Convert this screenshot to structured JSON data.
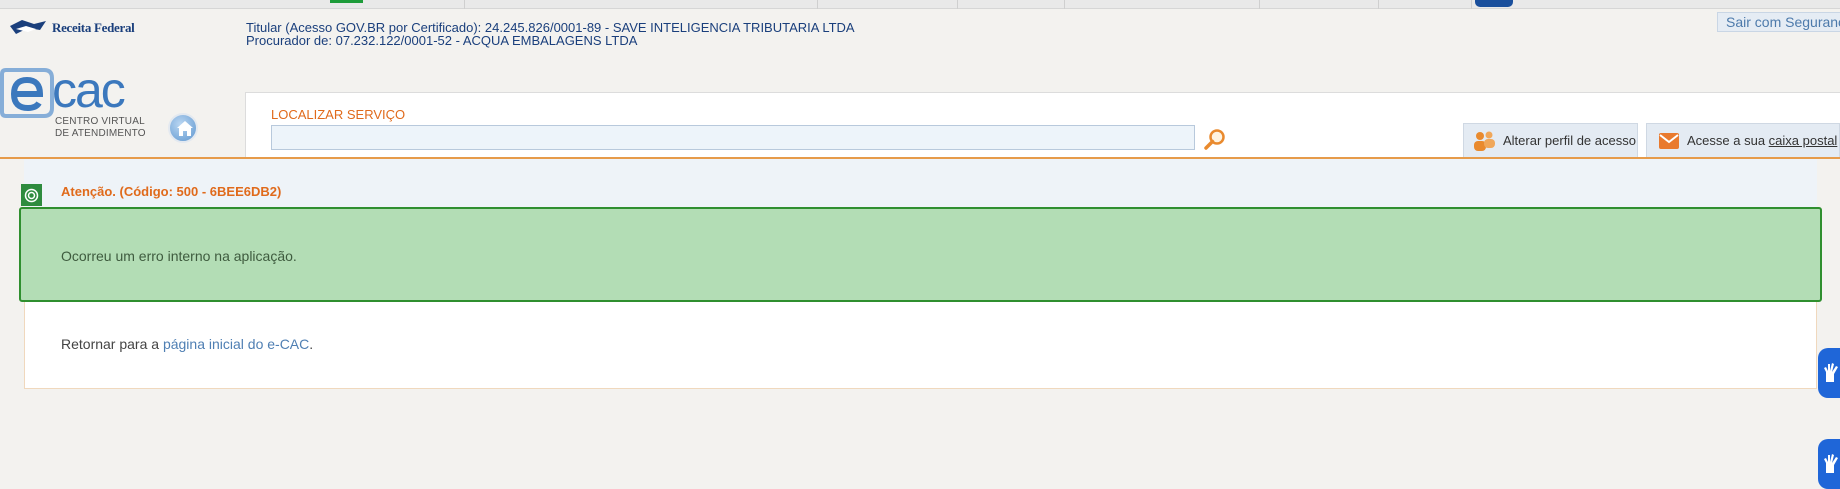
{
  "header": {
    "brand": "Receita Federal",
    "titular": "Titular (Acesso GOV.BR por Certificado): 24.245.826/0001-89 - SAVE INTELIGENCIA TRIBUTARIA LTDA",
    "procurador": "Procurador de: 07.232.122/0001-52 - ACQUA EMBALAGENS LTDA",
    "logout_label": "Sair com Seguranç",
    "ecac_logo_text": "cac",
    "ecac_subtitle_1": "CENTRO VIRTUAL",
    "ecac_subtitle_2": "DE ATENDIMENTO"
  },
  "search": {
    "label": "LOCALIZAR SERVIÇO",
    "value": "",
    "placeholder": ""
  },
  "actions": {
    "profile_label": "Alterar perfil de acesso",
    "mail_prefix": "Acesse a sua ",
    "mail_link": "caixa postal"
  },
  "alert": {
    "title": "Atenção. (Código: 500 - 6BEE6DB2)",
    "message": "Ocorreu um erro interno na aplicação."
  },
  "return": {
    "prefix": "Retornar para a ",
    "link": "página inicial do e-CAC",
    "suffix": "."
  },
  "colors": {
    "accent_orange": "#e06a1b",
    "brand_blue": "#1a3f7c",
    "success_green": "#2f8f2f",
    "alert_bg": "#b3ddb5",
    "vlibras_blue": "#1f66d8"
  },
  "icons": [
    "receita-federal-logo-icon",
    "home-icon",
    "search-icon",
    "users-icon",
    "mail-icon",
    "attention-icon",
    "hand-libras-icon"
  ]
}
